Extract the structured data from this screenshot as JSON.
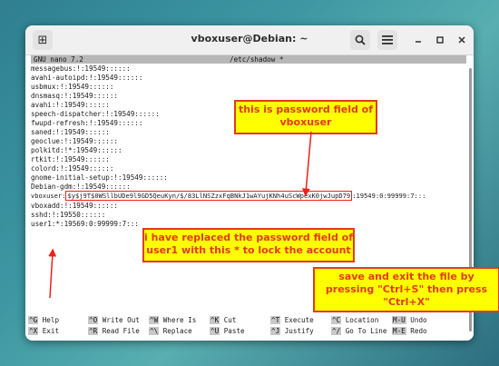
{
  "window": {
    "title": "vboxuser@Debian: ~",
    "new_tab_icon": "⊞",
    "search_icon": "🔍",
    "menu_icon": "≡",
    "min_icon": "–",
    "max_icon": "□",
    "close_icon": "✕"
  },
  "nano": {
    "version": "GNU nano 7.2",
    "filename": "/etc/shadow *"
  },
  "lines": [
    "messagebus:!:19549::::::",
    "avahi-autoipd:!:19549::::::",
    "usbmux:!:19549::::::",
    "dnsmasq:!:19549::::::",
    "avahi:!:19549::::::",
    "speech-dispatcher:!:19549::::::",
    "fwupd-refresh:!:19549::::::",
    "saned:!:19549::::::",
    "geoclue:!:19549::::::",
    "polkitd:!*:19549::::::",
    "rtkit:!:19549::::::",
    "colord:!:19549::::::",
    "gnome-initial-setup:!:19549::::::",
    "Debian-gdm:!:19549::::::"
  ],
  "vboxuser_line": {
    "prefix": "vboxuser:",
    "hash": "$y$j9T$0WSllbUDe9l9GD5QeuKyn/$/83LlNSZzxFqBNkJ1wAYujKNh4uScWpexK0jwJupD79",
    "suffix": ":19549:0:99999:7:::"
  },
  "lines_after": [
    "vboxadd:!:19549::::::",
    "sshd:!:19550::::::",
    "user1:*:19569:0:99999:7:::"
  ],
  "shortcuts": {
    "row1": [
      {
        "key": "^G",
        "label": "Help"
      },
      {
        "key": "^O",
        "label": "Write Out"
      },
      {
        "key": "^W",
        "label": "Where Is"
      },
      {
        "key": "^K",
        "label": "Cut"
      },
      {
        "key": "^T",
        "label": "Execute"
      },
      {
        "key": "^C",
        "label": "Location"
      },
      {
        "key": "M-U",
        "label": "Undo"
      }
    ],
    "row2": [
      {
        "key": "^X",
        "label": "Exit"
      },
      {
        "key": "^R",
        "label": "Read File"
      },
      {
        "key": "^\\",
        "label": "Replace"
      },
      {
        "key": "^U",
        "label": "Paste"
      },
      {
        "key": "^J",
        "label": "Justify"
      },
      {
        "key": "^/",
        "label": "Go To Line"
      },
      {
        "key": "M-E",
        "label": "Redo"
      }
    ]
  },
  "annotations": {
    "password_field": [
      "this is password field of",
      "vboxuser"
    ],
    "replaced": [
      "i have replaced the password field of",
      "user1 with this * to lock the account"
    ],
    "save_exit": [
      "save and exit the file by",
      "pressing \"Ctrl+S\" then press",
      "\"Ctrl+X\""
    ]
  },
  "colors": {
    "annotation_fill": "#ffff00",
    "annotation_text": "#e23b1a",
    "highlight_border": "#e8231c"
  }
}
